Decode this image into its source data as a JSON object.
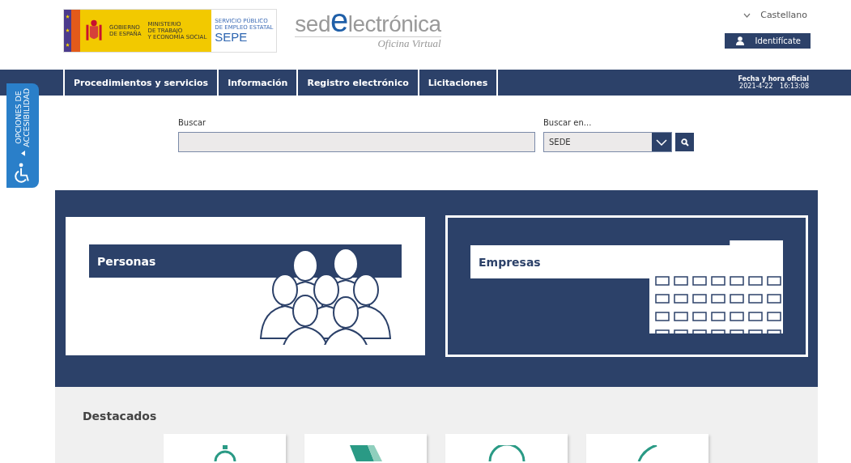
{
  "header": {
    "gov_logo": {
      "line_1": "GOBIERNO",
      "line_2": "DE ESPAÑA",
      "ministry": [
        "MINISTERIO",
        "DE TRABAJO",
        "Y ECONOMÍA SOCIAL"
      ],
      "agency_small": [
        "SERVICIO PÚBLICO",
        "DE EMPLEO ESTATAL"
      ],
      "agency": "SEPE"
    },
    "site_logo": {
      "prefix": "sed",
      "mark": "e",
      "suffix": "lectrónica",
      "subtitle": "Oficina Virtual"
    },
    "language": "Castellano",
    "login_button": "Identifícate"
  },
  "nav": {
    "items": [
      "Procedimientos y servicios",
      "Información",
      "Registro electrónico",
      "Licitaciones"
    ],
    "clock_title": "Fecha y hora oficial",
    "clock_date": "2021-4-22",
    "clock_time": "16:13:08"
  },
  "accessibility_tab": {
    "line_1": "OPCIONES DE",
    "line_2": "ACCESIBILIDAD"
  },
  "search": {
    "label": "Buscar",
    "scope_label": "Buscar en...",
    "scope_value": "SEDE"
  },
  "profiles": [
    {
      "label": "Personas",
      "kind": "people",
      "selected": false
    },
    {
      "label": "Empresas",
      "kind": "buildings",
      "selected": true
    }
  ],
  "featured": {
    "title": "Destacados",
    "cards": [
      {
        "kind": "clock"
      },
      {
        "kind": "chevron"
      },
      {
        "kind": "ring"
      },
      {
        "kind": "arc"
      }
    ]
  }
}
